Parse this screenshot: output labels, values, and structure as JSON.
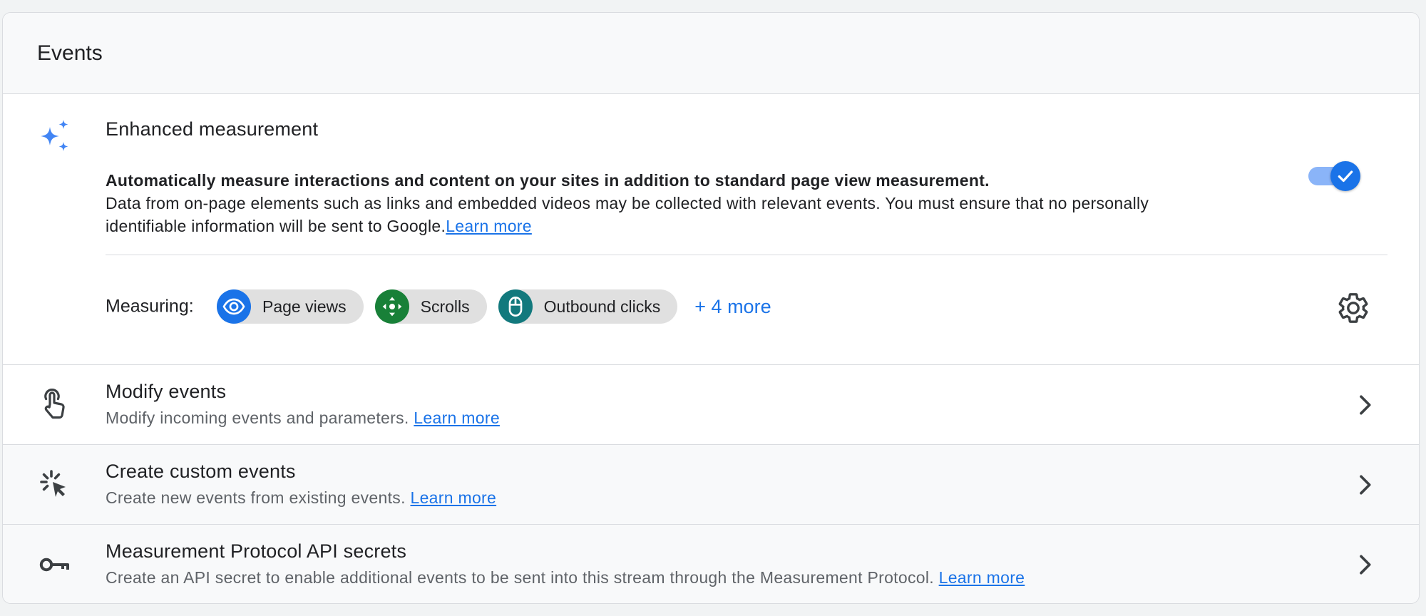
{
  "header": {
    "title": "Events"
  },
  "enhanced": {
    "title": "Enhanced measurement",
    "description_bold": "Automatically measure interactions and content on your sites in addition to standard page view measurement.",
    "description": "Data from on-page elements such as links and embedded videos may be collected with relevant events. You must ensure that no personally identifiable information will be sent to Google.",
    "learn_more": "Learn more",
    "toggle_on": true,
    "measuring_label": "Measuring:",
    "chips": [
      {
        "label": "Page views",
        "icon": "eye-icon",
        "color": "#1a73e8"
      },
      {
        "label": "Scrolls",
        "icon": "scroll-arrows-icon",
        "color": "#188038"
      },
      {
        "label": "Outbound clicks",
        "icon": "mouse-icon",
        "color": "#12797d"
      }
    ],
    "more_label": "+ 4 more"
  },
  "rows": [
    {
      "title": "Modify events",
      "subtitle": "Modify incoming events and parameters. ",
      "learn_more": "Learn more",
      "icon": "touch-hand-icon"
    },
    {
      "title": "Create custom events",
      "subtitle": "Create new events from existing events. ",
      "learn_more": "Learn more",
      "icon": "cursor-click-icon"
    },
    {
      "title": "Measurement Protocol API secrets",
      "subtitle": "Create an API secret to enable additional events to be sent into this stream through the Measurement Protocol. ",
      "learn_more": "Learn more",
      "icon": "key-icon"
    }
  ],
  "colors": {
    "accent": "#1a73e8",
    "toggle_track": "#8ab4f8",
    "chip_bg": "#e0e0e0"
  }
}
